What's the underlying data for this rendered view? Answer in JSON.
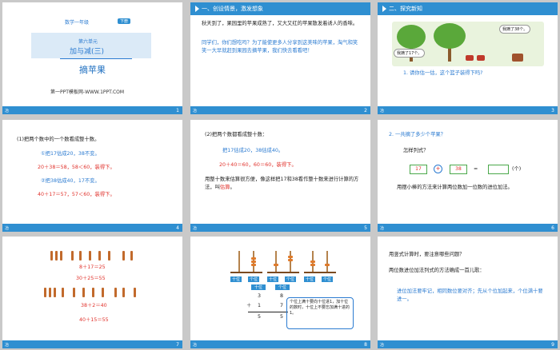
{
  "footer": {
    "left_label": "冶"
  },
  "slides": [
    {
      "num": "1",
      "grade": "数学一年级",
      "tag": "下册",
      "unit": "第六单元",
      "title": "加与减(三)",
      "subtitle": "摘苹果",
      "url": "第一PPT模板网-WWW.1PPT.COM"
    },
    {
      "num": "2",
      "header": "一、创设情景，激发想象",
      "p1": "秋天到了，果园里的苹果成熟了，又大又红的苹果散发着诱人的香味。",
      "p2": "同学们，你们想吃吗？为了能使更多人分享到这美味的苹果，淘气和笑笑一大早就赶到果园去摘苹果，我们快去看看吧！"
    },
    {
      "num": "3",
      "header": "二、探究新知",
      "bubble1": "我摘了17个。",
      "bubble2": "我摘了38个。",
      "question": "1. 请你估一估，这个篮子装得下吗?"
    },
    {
      "num": "4",
      "line0": "(1)把两个数中的一个数看成整十数。",
      "line1": "①把17估成20，38不变。",
      "line2": "20＋38＝58，58＜60，装得下。",
      "line3": "②把38估成40，17不变。",
      "line4": "40＋17＝57，57＜60，装得下。"
    },
    {
      "num": "5",
      "line0": "(2)把两个数都看成整十数：",
      "line1": "把17估成20，38估成40。",
      "line2": "20＋40＝60，60＝60，装得下。",
      "line3": "用整十数来估算很方便，像这样把17和38看作整十数来进行计算的方法，叫",
      "line3b": "估算",
      "line3c": "。"
    },
    {
      "num": "6",
      "header": "2. 一共摘了多少个苹果？",
      "ask": "怎样列式？",
      "a": "17",
      "op": "+",
      "b": "38",
      "eq": "=",
      "unit": "(个)",
      "desc": "用摆小棒的方法来计算两位数加一位数的进位加法。"
    },
    {
      "num": "7",
      "eq1": "8＋17＝25",
      "eq2": "30＋25＝55",
      "eq3": "38＋2＝40",
      "eq4": "40＋15＝55"
    },
    {
      "num": "8",
      "ab1a": "十位",
      "ab1b": "个位",
      "ab2a": "十位",
      "ab2b": "个位",
      "ab3a": "十位",
      "ab3b": "个位",
      "col_tens": "十位",
      "col_ones": "个位",
      "r1a": "3",
      "r1b": "8",
      "r2op": "＋",
      "r2a": "1",
      "r2b": "7",
      "r3a": "5",
      "r3b": "5",
      "note": "个位上满十要向十位进1，加十位的数时，十位上不要忘加满十进的1。"
    },
    {
      "num": "9",
      "q1": "用竖式计算时，要注意哪些问题？",
      "q2": "两位数进位加法列式的方法确成一首儿歌：",
      "s1": "进位加法要牢记，相同数位要对齐；先从个位加起来，个位满十要进一。"
    }
  ]
}
